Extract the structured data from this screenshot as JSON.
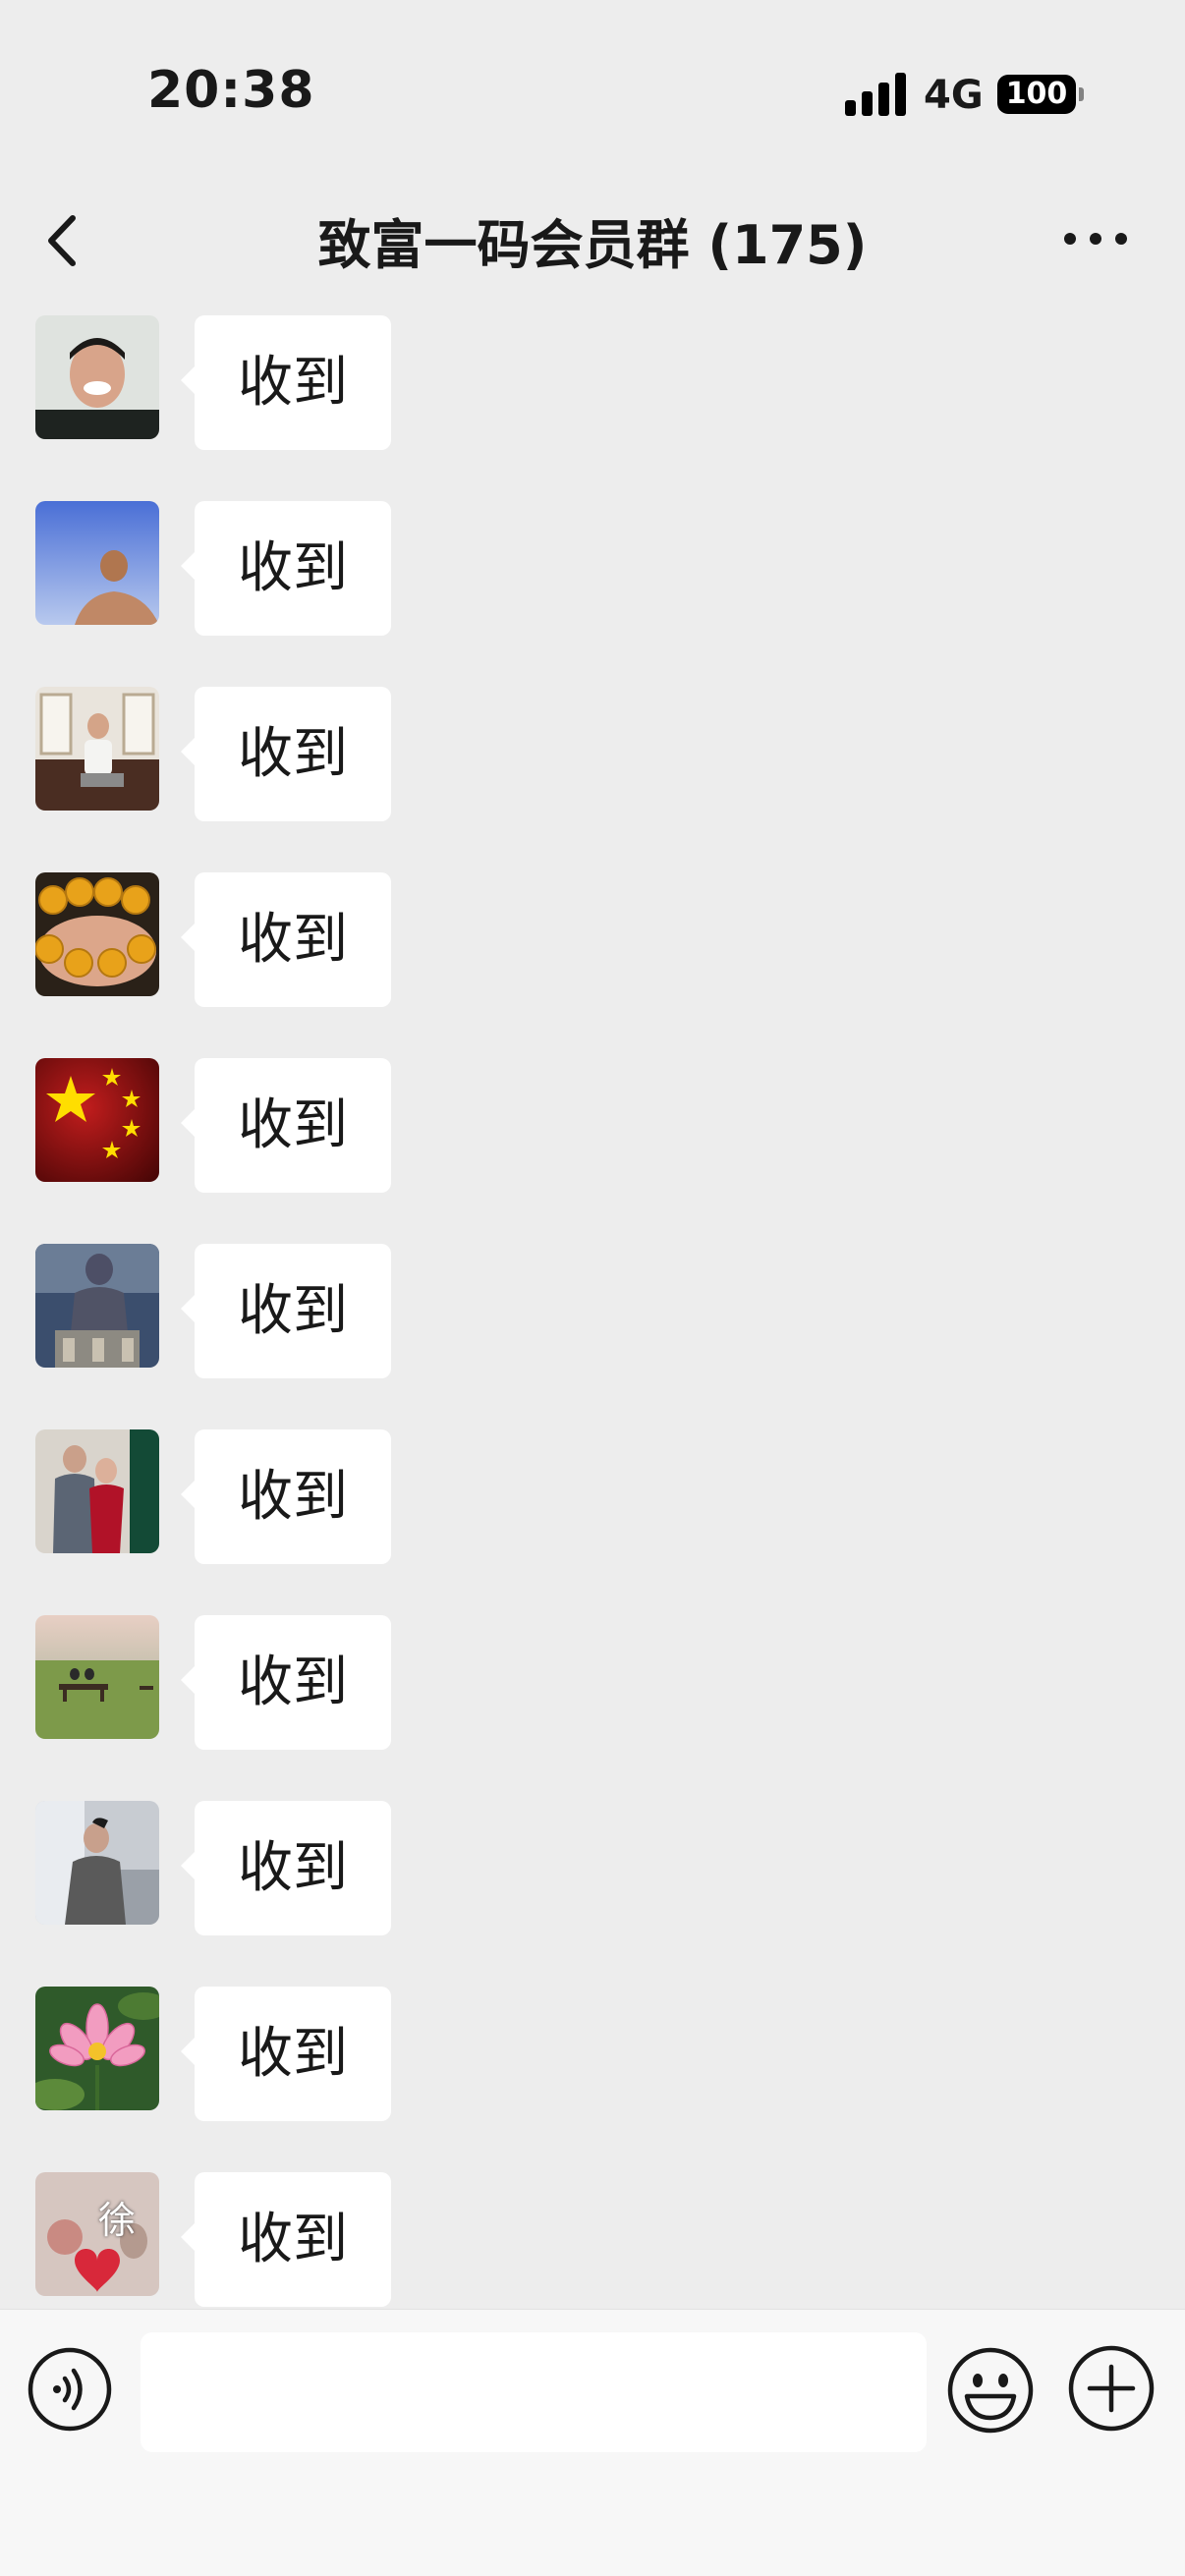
{
  "status_bar": {
    "time": "20:38",
    "network": "4G",
    "battery": "100"
  },
  "header": {
    "title": "致富一码会员群 (175)",
    "icons": {
      "back": "chevron-left-icon",
      "more": "more-dots-icon"
    }
  },
  "messages": [
    {
      "text": "收到",
      "avatar": "avatar-smiling-man"
    },
    {
      "text": "收到",
      "avatar": "avatar-man-blue-sky"
    },
    {
      "text": "收到",
      "avatar": "avatar-man-on-sofa"
    },
    {
      "text": "收到",
      "avatar": "avatar-amber-beads"
    },
    {
      "text": "收到",
      "avatar": "avatar-china-flag"
    },
    {
      "text": "收到",
      "avatar": "avatar-statue-figure"
    },
    {
      "text": "收到",
      "avatar": "avatar-couple-photo"
    },
    {
      "text": "收到",
      "avatar": "avatar-grassland-bench"
    },
    {
      "text": "收到",
      "avatar": "avatar-man-in-coat"
    },
    {
      "text": "收到",
      "avatar": "avatar-pink-lotus"
    },
    {
      "text": "收到",
      "avatar": "avatar-xu-heart",
      "avatar_text": "徐"
    }
  ],
  "input_bar": {
    "placeholder": "",
    "icons": {
      "voice": "voice-icon",
      "emoji": "emoji-icon",
      "more": "plus-icon"
    }
  },
  "colors": {
    "background": "#ededed",
    "bubble": "#ffffff",
    "text": "#191919",
    "input_bar": "#f7f7f7"
  }
}
